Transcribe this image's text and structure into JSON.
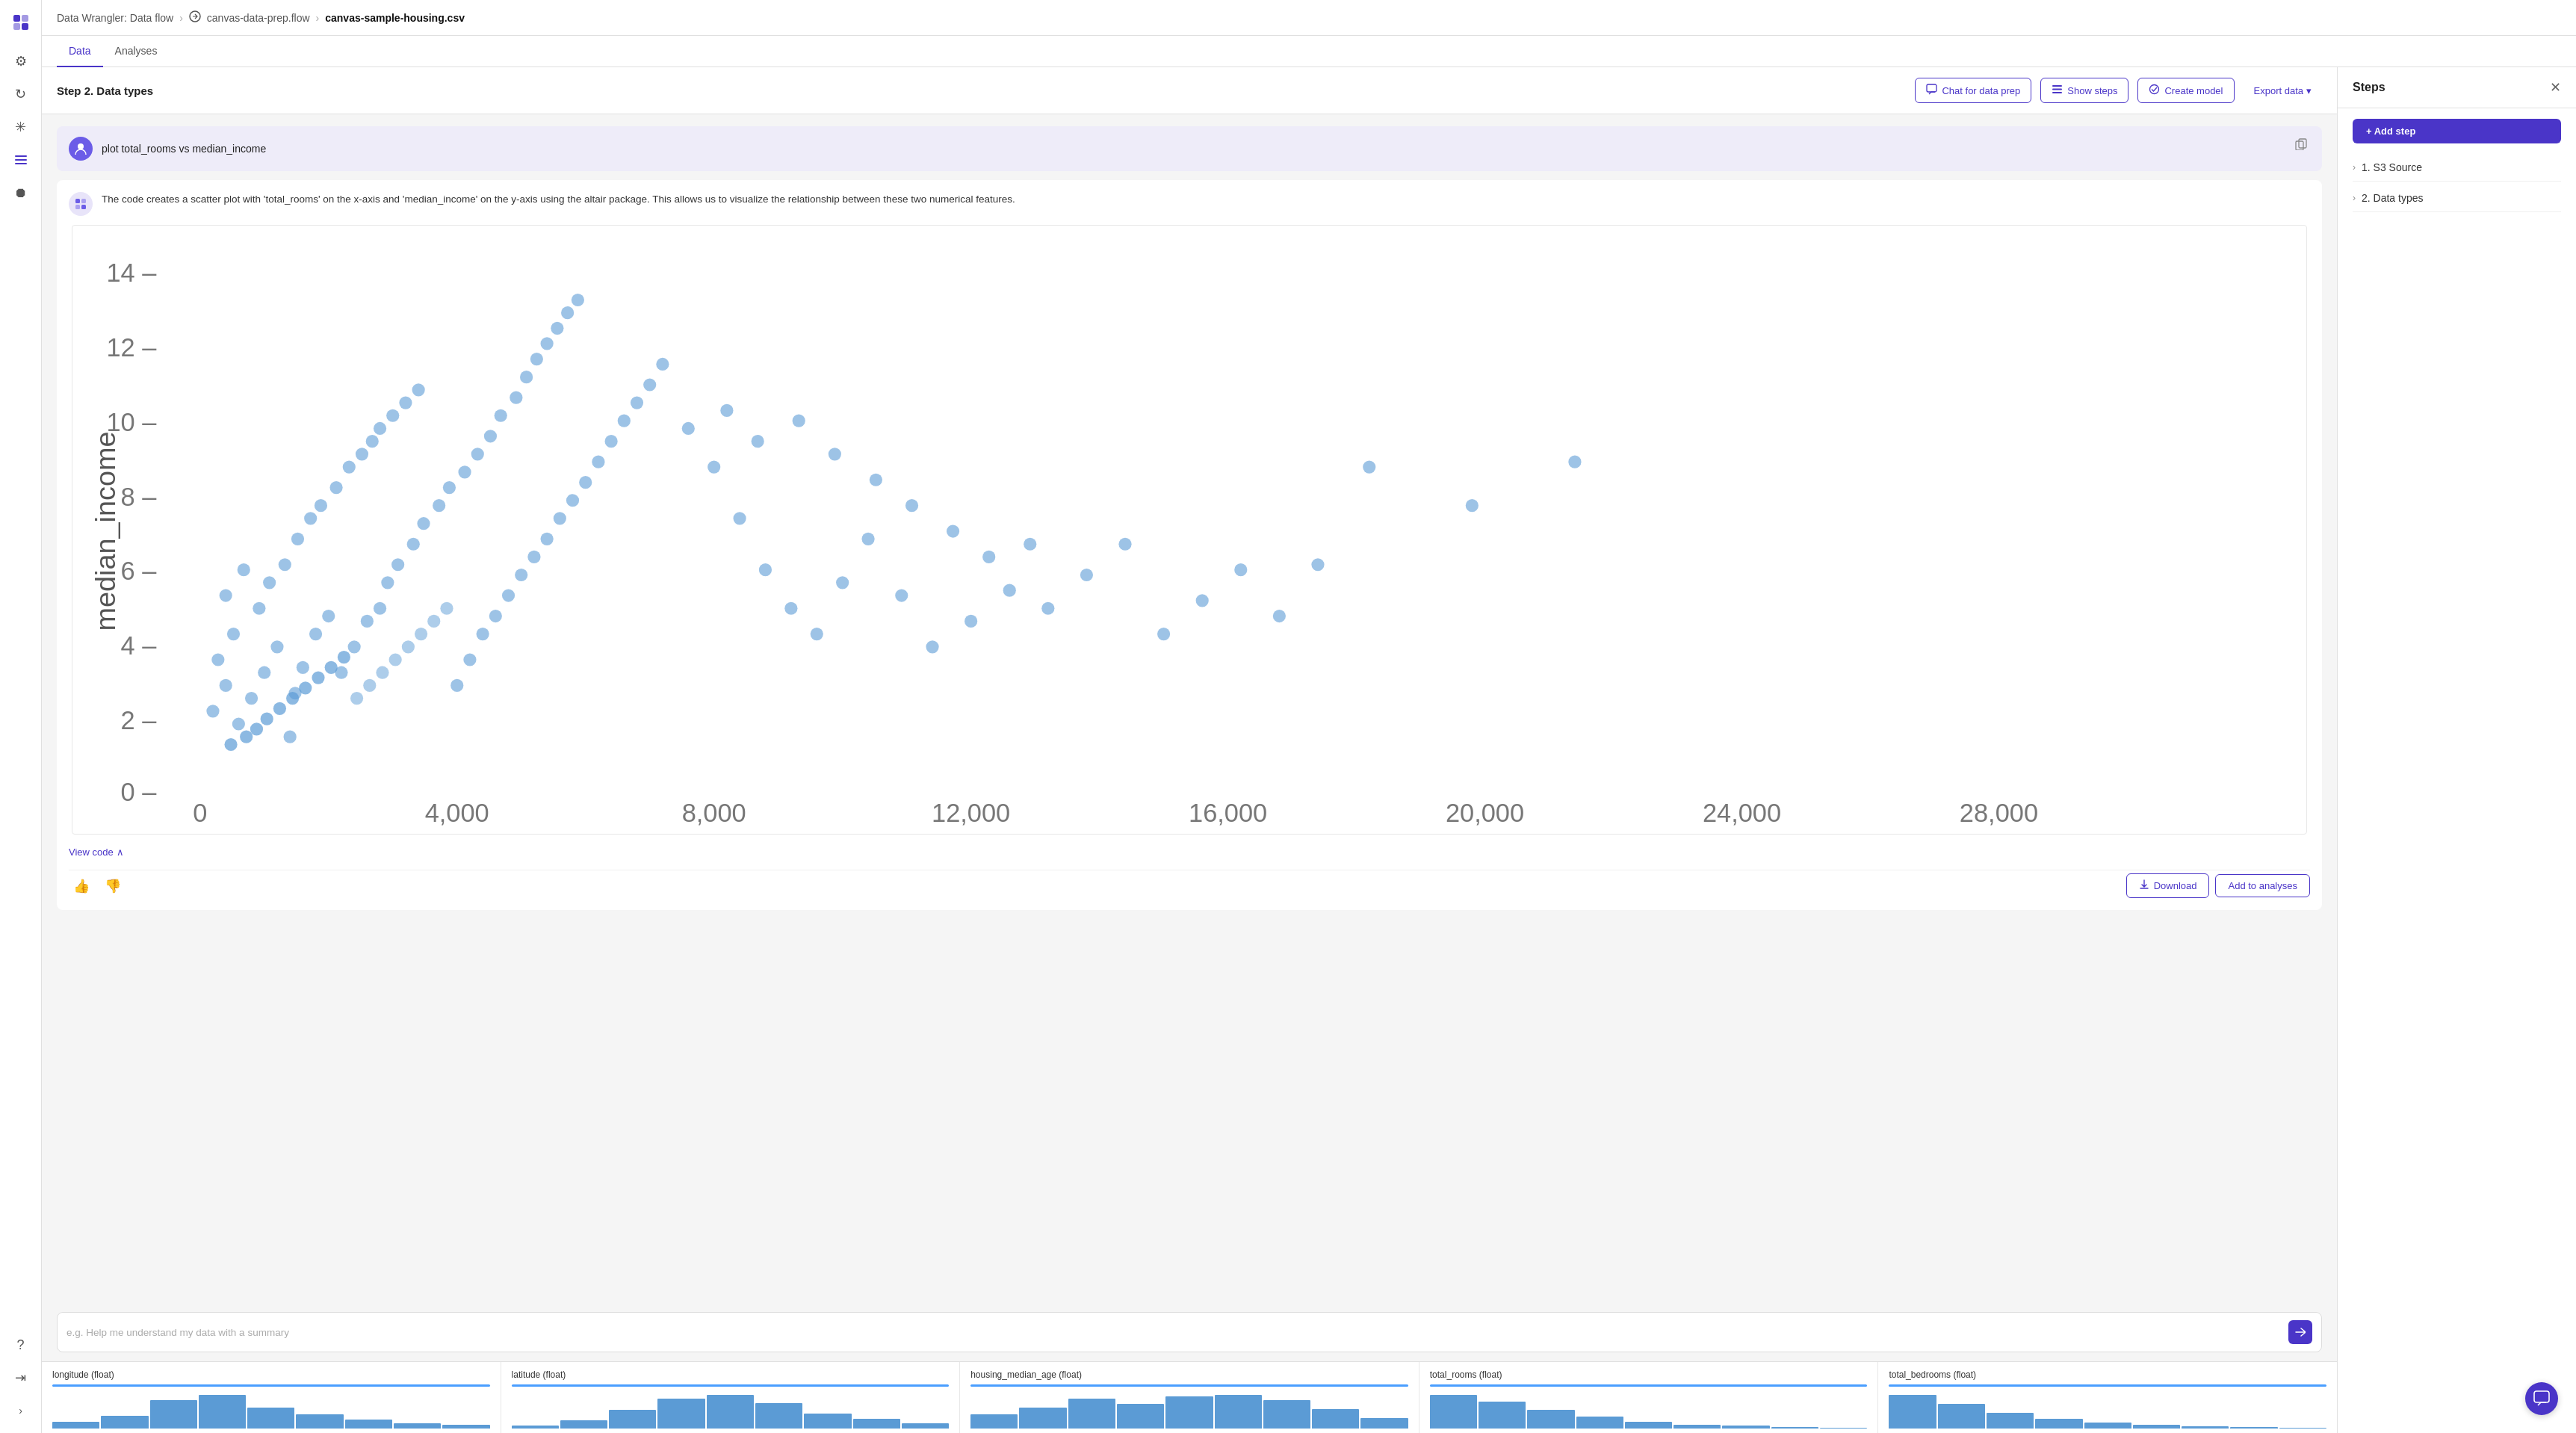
{
  "breadcrumb": {
    "root": "Data Wrangler: Data flow",
    "sep1": "›",
    "middle": "canvas-data-prep.flow",
    "sep2": "›",
    "current": "canvas-sample-housing.csv"
  },
  "tabs": [
    {
      "label": "Data",
      "active": true
    },
    {
      "label": "Analyses",
      "active": false
    }
  ],
  "toolbar": {
    "step_title": "Step 2. Data types",
    "chat_btn": "Chat for data prep",
    "show_steps_btn": "Show steps",
    "create_model_btn": "Create model",
    "export_btn": "Export data"
  },
  "chat": {
    "user_query": "plot total_rooms vs median_income",
    "ai_response": "The code creates a scatter plot with 'total_rooms' on the x-axis and 'median_income' on the y-axis using the altair package. This allows us to visualize the relationship between these two numerical features.",
    "view_code_label": "View code",
    "download_label": "Download",
    "add_analyses_label": "Add to analyses",
    "input_placeholder": "e.g. Help me understand my data with a summary"
  },
  "chart": {
    "x_label": "total_rooms",
    "y_label": "median_income",
    "x_ticks": [
      "0",
      "4,000",
      "8,000",
      "12,000",
      "16,000",
      "20,000",
      "24,000",
      "28,000"
    ],
    "y_ticks": [
      "0 –",
      "2 –",
      "4 –",
      "6 –",
      "8 –",
      "10 –",
      "12 –",
      "14 –"
    ]
  },
  "columns": [
    {
      "name": "longitude (float)",
      "bars": [
        20,
        35,
        80,
        95,
        60,
        40,
        25,
        15,
        10
      ]
    },
    {
      "name": "latitude (float)",
      "bars": [
        10,
        25,
        55,
        90,
        100,
        75,
        45,
        30,
        15
      ]
    },
    {
      "name": "housing_median_age (float)",
      "bars": [
        40,
        60,
        85,
        70,
        90,
        95,
        80,
        55,
        30
      ]
    },
    {
      "name": "total_rooms (float)",
      "bars": [
        100,
        80,
        55,
        35,
        20,
        12,
        8,
        5,
        3
      ]
    },
    {
      "name": "total_bedrooms (float)",
      "bars": [
        95,
        70,
        45,
        28,
        16,
        10,
        6,
        4,
        2
      ]
    }
  ],
  "steps_panel": {
    "title": "Steps",
    "add_step_label": "+ Add step",
    "steps": [
      {
        "id": "1",
        "label": "1. S3 Source"
      },
      {
        "id": "2",
        "label": "2. Data types"
      }
    ]
  },
  "nav_icons": [
    {
      "name": "logo-icon",
      "symbol": "🔷"
    },
    {
      "name": "settings-icon",
      "symbol": "⚙"
    },
    {
      "name": "refresh-icon",
      "symbol": "↻"
    },
    {
      "name": "asterisk-icon",
      "symbol": "✳"
    },
    {
      "name": "list-icon",
      "symbol": "☰"
    },
    {
      "name": "toggle-icon",
      "symbol": "⏺"
    },
    {
      "name": "question-icon",
      "symbol": "?"
    },
    {
      "name": "export-nav-icon",
      "symbol": "⇥"
    },
    {
      "name": "expand-icon",
      "symbol": "›"
    }
  ],
  "colors": {
    "accent": "#4a35c8",
    "dot_color": "#5b9bd5",
    "bar_color": "#5b9bd5"
  }
}
